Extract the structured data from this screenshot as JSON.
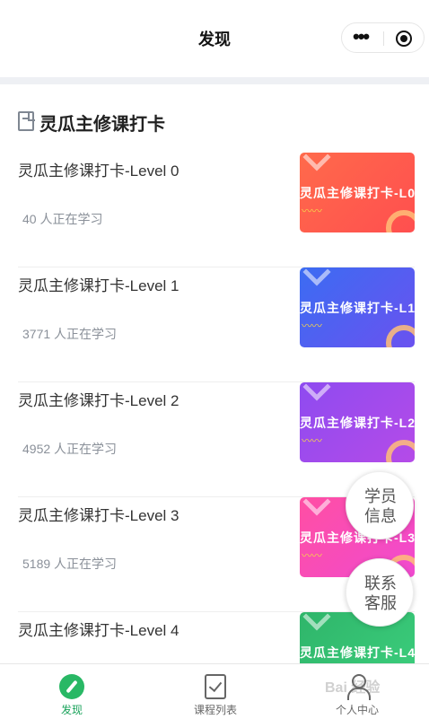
{
  "navbar": {
    "title": "发现"
  },
  "section": {
    "title": "灵瓜主修课打卡"
  },
  "courses": [
    {
      "title": "灵瓜主修课打卡-Level 0",
      "count": "40 人正在学习",
      "thumb_label": "灵瓜主修课打卡-L0",
      "color_from": "#ff6a4b",
      "color_to": "#ff4f4f"
    },
    {
      "title": "灵瓜主修课打卡-Level 1",
      "count": "3771 人正在学习",
      "thumb_label": "灵瓜主修课打卡-L1",
      "color_from": "#3b6cf2",
      "color_to": "#6a52f0"
    },
    {
      "title": "灵瓜主修课打卡-Level 2",
      "count": "4952 人正在学习",
      "thumb_label": "灵瓜主修课打卡-L2",
      "color_from": "#8e4bf0",
      "color_to": "#b54be8"
    },
    {
      "title": "灵瓜主修课打卡-Level 3",
      "count": "5189 人正在学习",
      "thumb_label": "灵瓜主修课打卡-L3",
      "color_from": "#ff4fa3",
      "color_to": "#f04ad0"
    },
    {
      "title": "灵瓜主修课打卡-Level 4",
      "count": "",
      "thumb_label": "灵瓜主修课打卡-L4",
      "color_from": "#2fb56a",
      "color_to": "#3ccf7d"
    }
  ],
  "float_buttons": {
    "student_info": [
      "学员",
      "信息"
    ],
    "customer_service": [
      "联系",
      "客服"
    ]
  },
  "tabbar": {
    "tabs": [
      {
        "label": "发现",
        "icon": "compass-icon",
        "active": true
      },
      {
        "label": "课程列表",
        "icon": "checklist-icon",
        "active": false
      },
      {
        "label": "个人中心",
        "icon": "person-icon",
        "active": false
      }
    ]
  },
  "watermark": "Bai 经验",
  "colors": {
    "accent": "#29b865",
    "muted_text": "#8a9099",
    "page_divider": "#eef0f4"
  }
}
